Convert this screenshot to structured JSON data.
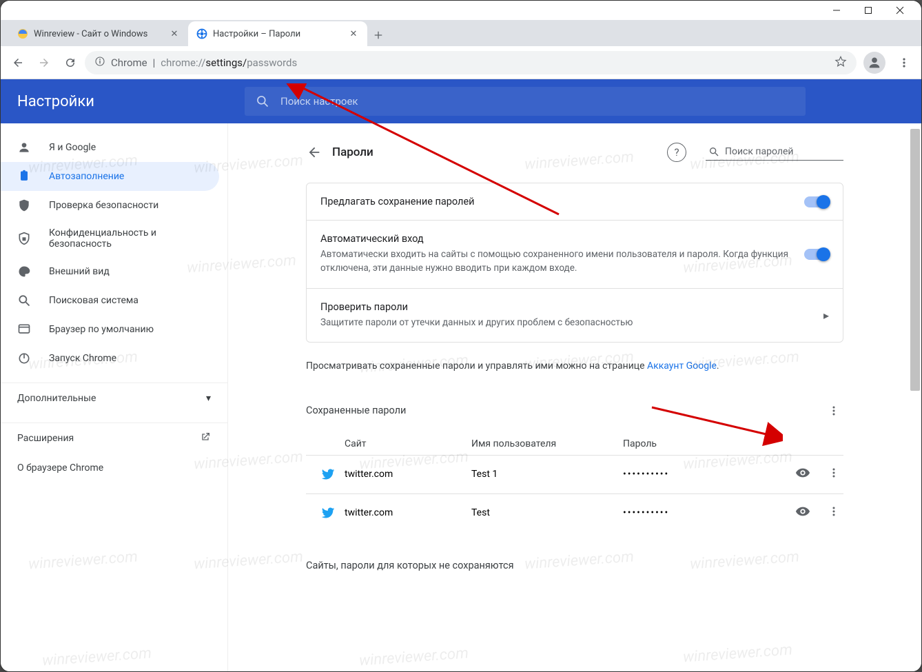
{
  "watermark": "winreviewer.com",
  "window_controls": {
    "minimize": "—",
    "maximize": "□",
    "close": "✕"
  },
  "tabs": [
    {
      "title": "Winreview - Сайт о Windows",
      "active": false
    },
    {
      "title": "Настройки – Пароли",
      "active": true
    }
  ],
  "omnibox": {
    "source": "Chrome",
    "sep": " | ",
    "url_prefix": "chrome://",
    "url_mid": "settings/",
    "url_end": "passwords"
  },
  "header": {
    "brand": "Настройки",
    "search_placeholder": "Поиск настроек"
  },
  "sidebar": [
    {
      "icon": "person",
      "label": "Я и Google"
    },
    {
      "icon": "autofill",
      "label": "Автозаполнение",
      "active": true
    },
    {
      "icon": "shield",
      "label": "Проверка безопасности"
    },
    {
      "icon": "lock",
      "label": "Конфиденциальность и безопасность"
    },
    {
      "icon": "palette",
      "label": "Внешний вид"
    },
    {
      "icon": "search",
      "label": "Поисковая система"
    },
    {
      "icon": "default",
      "label": "Браузер по умолчанию"
    },
    {
      "icon": "power",
      "label": "Запуск Chrome"
    }
  ],
  "advanced": "Дополнительные",
  "extensions": "Расширения",
  "about": "О браузере Chrome",
  "page": {
    "title": "Пароли",
    "search_placeholder": "Поиск паролей",
    "offer_save": "Предлагать сохранение паролей",
    "autosignin_title": "Автоматический вход",
    "autosignin_desc": "Автоматически входить на сайты с помощью сохраненного имени пользователя и пароля. Когда функция отключена, эти данные нужно вводить при каждом входе.",
    "check_title": "Проверить пароли",
    "check_desc": "Защитите пароли от утечки данных и других проблем с безопасностью",
    "info_pre": "Просматривать сохраненные пароли и управлять ими можно на странице ",
    "info_link": "Аккаунт Google",
    "saved_header": "Сохраненные пароли",
    "columns": {
      "site": "Сайт",
      "user": "Имя пользователя",
      "pass": "Пароль"
    },
    "rows": [
      {
        "site": "twitter.com",
        "user": "Test 1",
        "pass": "••••••••••"
      },
      {
        "site": "twitter.com",
        "user": "Test",
        "pass": "••••••••••"
      }
    ],
    "never_saved": "Сайты, пароли для которых не сохраняются"
  }
}
